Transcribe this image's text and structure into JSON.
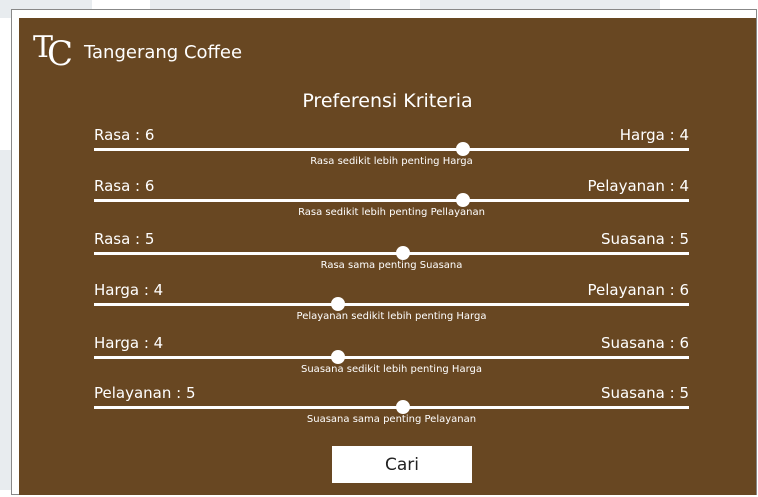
{
  "brand": {
    "logo_text": "TC",
    "name": "Tangerang Coffee"
  },
  "title": "Preferensi Kriteria",
  "sliders": [
    {
      "left": "Rasa : 6",
      "right": "Harga : 4",
      "desc": "Rasa sedikit lebih penting Harga",
      "value": 0.62
    },
    {
      "left": "Rasa : 6",
      "right": "Pelayanan : 4",
      "desc": "Rasa sedikit lebih penting Pellayanan",
      "value": 0.62
    },
    {
      "left": "Rasa : 5",
      "right": "Suasana : 5",
      "desc": "Rasa sama penting Suasana",
      "value": 0.52
    },
    {
      "left": "Harga : 4",
      "right": "Pelayanan : 6",
      "desc": "Pelayanan sedikit lebih penting Harga",
      "value": 0.41
    },
    {
      "left": "Harga : 4",
      "right": "Suasana : 6",
      "desc": "Suasana sedikit lebih penting Harga",
      "value": 0.41
    },
    {
      "left": "Pelayanan : 5",
      "right": "Suasana : 5",
      "desc": "Suasana sama penting Pelayanan",
      "value": 0.52
    }
  ],
  "search_button": "Cari",
  "colors": {
    "panel": "#684722",
    "text": "#ffffff"
  }
}
